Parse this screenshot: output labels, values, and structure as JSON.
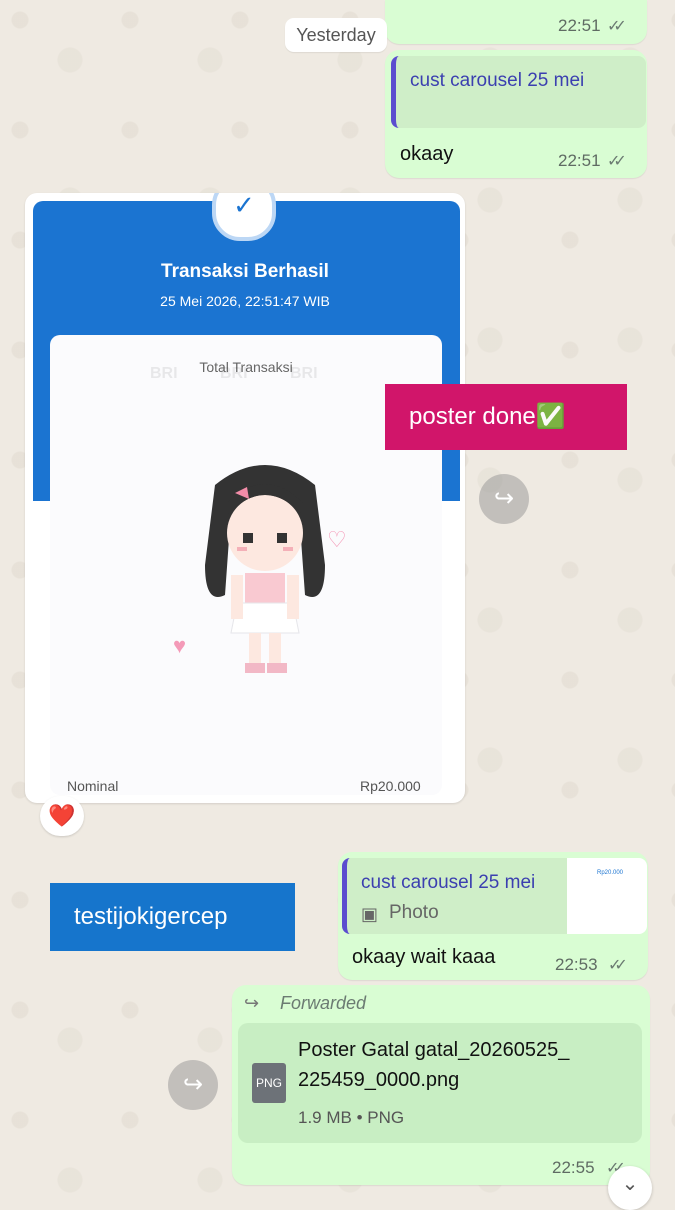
{
  "date_chip": "Yesterday",
  "msg_top": {
    "time": "22:51",
    "ticks": "✓✓"
  },
  "reply1": {
    "quote_title": "cust carousel 25 mei",
    "text": "okaay",
    "time": "22:51",
    "ticks": "✓✓"
  },
  "receipt": {
    "title": "Transaksi Berhasil",
    "datetime": "25 Mei 2026, 22:51:47 WIB",
    "total_label": "Total Transaksi",
    "watermark": "BRI",
    "nominal_label": "Nominal",
    "nominal_value": "Rp20.000",
    "reaction": "❤️"
  },
  "sticker_pink": {
    "text": "poster done✅"
  },
  "sticker_blue": {
    "text": "testijokigercep"
  },
  "reply2": {
    "quote_title": "cust carousel 25 mei",
    "quote_subtitle": "Photo",
    "thumb_amount": "Rp20.000",
    "text": "okaay wait kaaa",
    "time": "22:53",
    "ticks": "✓✓"
  },
  "forwarded": {
    "label": "Forwarded",
    "file_name_line1": "Poster Gatal gatal_20260525_",
    "file_name_line2": "225459_0000.png",
    "file_type": "PNG",
    "file_meta": "1.9 MB • PNG",
    "time": "22:55",
    "ticks": "✓✓"
  },
  "colors": {
    "accent_blue": "#1b74d1",
    "pink_sticker": "#d1156a",
    "blue_sticker": "#1675cc",
    "bubble_out": "#d9fdd3"
  }
}
